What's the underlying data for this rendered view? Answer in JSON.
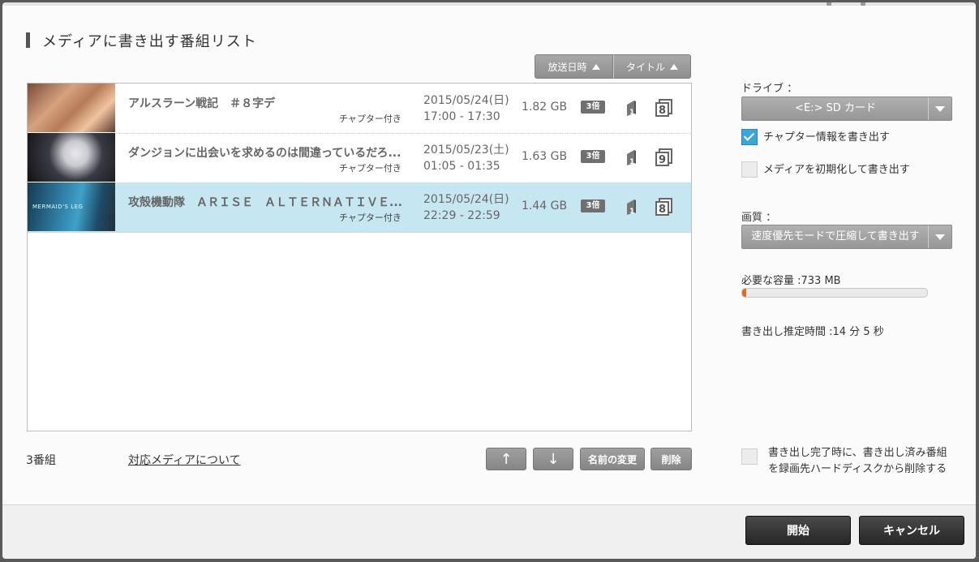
{
  "dialog": {
    "title": "メディアに書き出す番組リスト"
  },
  "sort": {
    "date_label": "放送日時",
    "title_label": "タイトル"
  },
  "programs": [
    {
      "title": "アルスラーン戦記　＃８字デ",
      "chapter": "チャプター付き",
      "date": "2015/05/24(日)",
      "time": "17:00 - 17:30",
      "size": "1.82 GB",
      "speed": "3倍",
      "count": "8",
      "selected": false
    },
    {
      "title": "ダンジョンに出会いを求めるのは間違っているだろ...",
      "chapter": "チャプター付き",
      "date": "2015/05/23(土)",
      "time": "01:05 - 01:35",
      "size": "1.63 GB",
      "speed": "3倍",
      "count": "9",
      "selected": false
    },
    {
      "title": "攻殻機動隊　ＡＲＩＳＥ　ＡＬＴＥＲＮＡＴＩＶＥ...",
      "chapter": "チャプター付き",
      "date": "2015/05/24(日)",
      "time": "22:29 - 22:59",
      "size": "1.44 GB",
      "speed": "3倍",
      "count": "8",
      "selected": true,
      "thumb_text": "MERMAID'S LEG"
    }
  ],
  "list_footer": {
    "count": "3番組",
    "media_link": "対応メディアについて",
    "up_label": "↑",
    "down_label": "↓",
    "rename_label": "名前の変更",
    "delete_label": "削除"
  },
  "settings": {
    "drive_label": "ドライブ ：",
    "drive_value": "<E:> SD カード",
    "chapter_checkbox": "チャプター情報を書き出す",
    "chapter_checked": true,
    "format_checkbox": "メディアを初期化して書き出す",
    "format_checked": false,
    "quality_label": "画質 ：",
    "quality_value": "速度優先モードで圧縮して書き出す",
    "capacity_label": "必要な容量 :733 MB",
    "capacity_fraction": 0.02,
    "time_label": "書き出し推定時間 :14 分 5 秒",
    "delete_after_line1": "書き出し完了時に、書き出し済み番組",
    "delete_after_line2": "を録画先ハードディスクから削除する",
    "delete_after_checked": false
  },
  "buttons": {
    "start": "開始",
    "cancel": "キャンセル"
  },
  "colors": {
    "selected_row": "#c6e6f2",
    "checkbox_on": "#3aa6dc",
    "progress": "#e86a12",
    "primary_button": "#2e2e2e"
  },
  "icons": {
    "disc": "disc-single-layer-icon",
    "chapter_count": "chapter-count-icon",
    "dropdown": "chevron-down-icon"
  }
}
